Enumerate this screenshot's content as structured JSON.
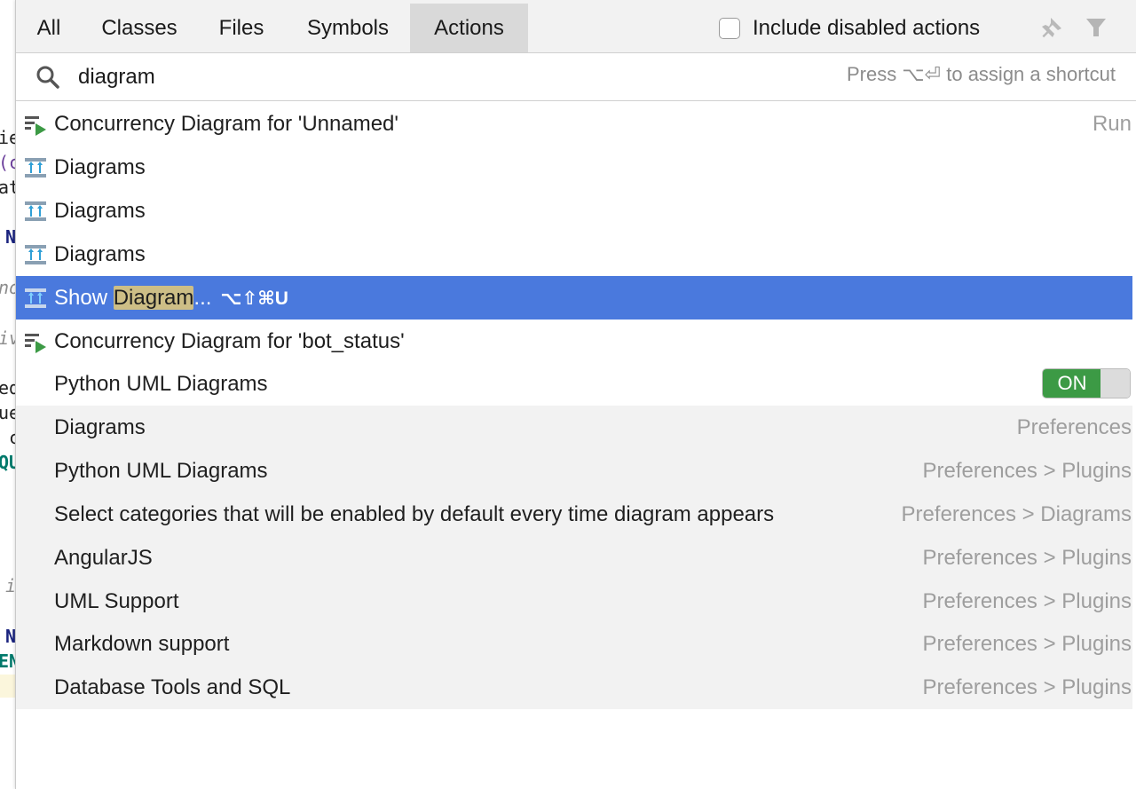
{
  "tabs": [
    "All",
    "Classes",
    "Files",
    "Symbols",
    "Actions"
  ],
  "include_disabled_label": "Include disabled actions",
  "search": {
    "value": "diagram",
    "hint": "Press ⌥⏎ to assign a shortcut"
  },
  "results": [
    {
      "icon": "run-concurrency-icon",
      "label": "Concurrency Diagram for 'Unnamed'",
      "right": "Run"
    },
    {
      "icon": "diagram-icon",
      "label": "Diagrams",
      "right": ""
    },
    {
      "icon": "diagram-icon",
      "label": "Diagrams",
      "right": ""
    },
    {
      "icon": "diagram-icon",
      "label": "Diagrams",
      "right": ""
    },
    {
      "icon": "diagram-icon",
      "label_prefix": "Show ",
      "label_match": "Diagram",
      "label_suffix": "...",
      "shortcut": "⌥⇧⌘U",
      "selected": true
    },
    {
      "icon": "run-concurrency-icon",
      "label": "Concurrency Diagram for 'bot_status'",
      "right": ""
    },
    {
      "icon": "",
      "label": "Python UML Diagrams",
      "toggle": "ON"
    }
  ],
  "preferences": [
    {
      "label": "Diagrams",
      "right": "Preferences"
    },
    {
      "label": "Python UML Diagrams",
      "right": "Preferences > Plugins"
    },
    {
      "label": "Select categories that will be enabled by default every time diagram appears",
      "right": "Preferences > Diagrams"
    },
    {
      "label": "AngularJS",
      "right": "Preferences > Plugins"
    },
    {
      "label": "UML Support",
      "right": "Preferences > Plugins"
    },
    {
      "label": "Markdown support",
      "right": "Preferences > Plugins"
    },
    {
      "label": "Database Tools and SQL",
      "right": "Preferences > Plugins"
    }
  ],
  "editor_fragments": [
    "ie",
    "(c",
    "at",
    "N",
    "no",
    "iv",
    "ed",
    "ue",
    " c",
    "QU",
    "i",
    "N",
    "EN"
  ],
  "colors": {
    "selection": "#4a79dd",
    "match_highlight": "#cdbe86",
    "toggle_on": "#3c9a45",
    "active_tab": "#d9d9d9"
  }
}
